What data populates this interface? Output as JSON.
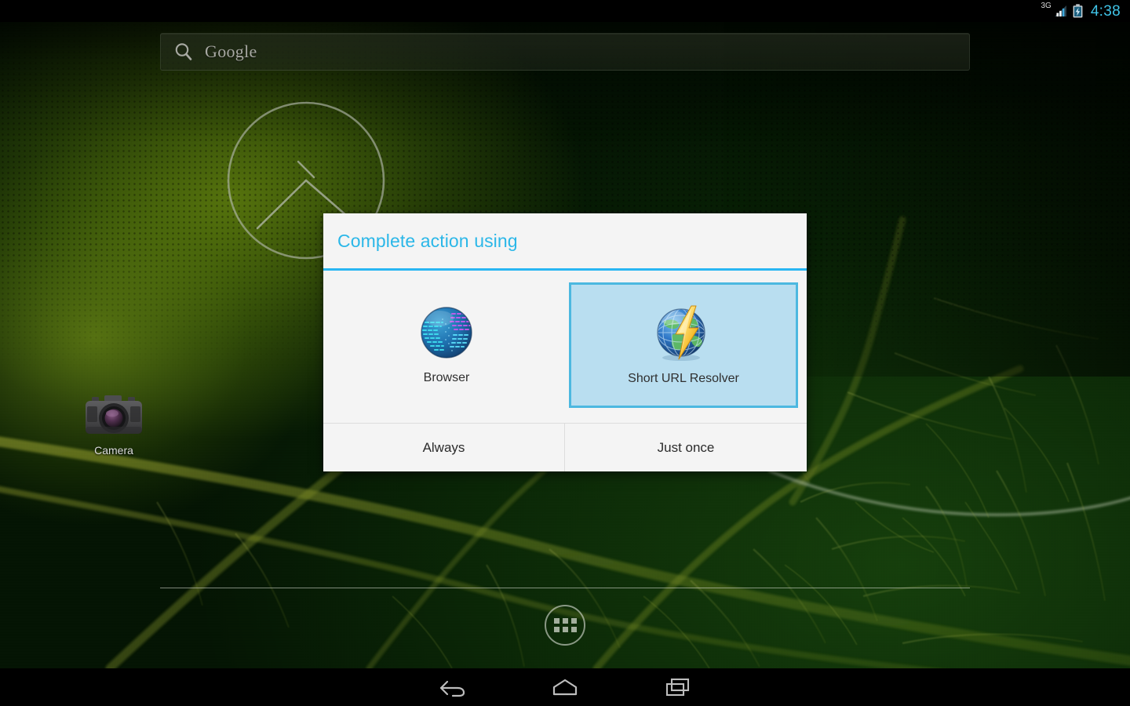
{
  "status_bar": {
    "network_label": "3G",
    "signal_icon": "signal-bars-icon",
    "battery_icon": "battery-charging-icon",
    "clock": "4:38",
    "clock_color": "#40c4e8"
  },
  "home_screen": {
    "search_widget": {
      "icon": "search-icon",
      "label": "Google"
    },
    "clock_widget": {
      "icon": "analog-clock-widget"
    },
    "shortcuts": [
      {
        "label": "Camera",
        "icon": "camera-icon"
      }
    ],
    "dock": {
      "app_drawer_label": "",
      "app_drawer_icon": "apps-grid-icon"
    }
  },
  "dialog": {
    "title": "Complete action using",
    "title_color": "#2bb7e8",
    "divider_color": "#29b6f2",
    "selected_background": "#b9def0",
    "selected_border": "#4cb8e0",
    "choices": [
      {
        "name": "Browser",
        "icon": "browser-globe-icon",
        "selected": false
      },
      {
        "name": "Short URL Resolver",
        "icon": "globe-lightning-icon",
        "selected": true
      }
    ],
    "buttons": [
      {
        "label": "Always"
      },
      {
        "label": "Just once"
      }
    ]
  },
  "nav_bar": {
    "back_label": "Back",
    "home_label": "Home",
    "recents_label": "Recent apps"
  }
}
